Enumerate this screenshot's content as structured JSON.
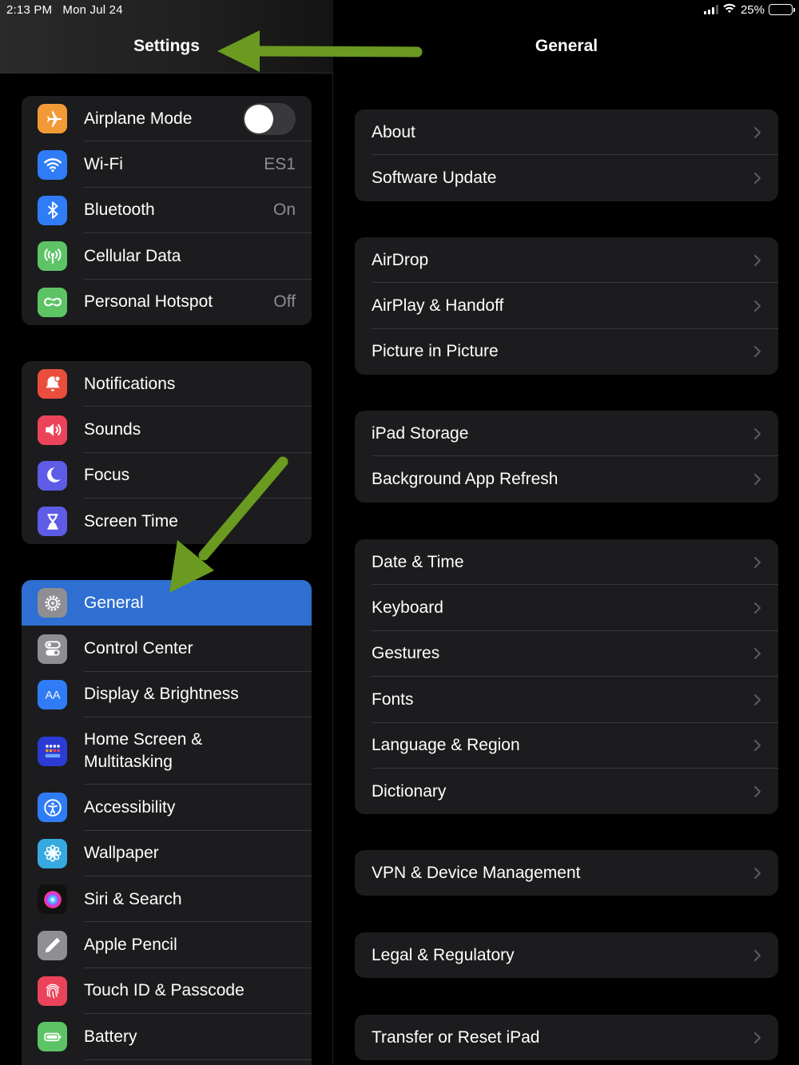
{
  "status": {
    "time": "2:13 PM",
    "date": "Mon Jul 24",
    "battery": "25%",
    "battery_level": 0.25
  },
  "sidebar": {
    "title": "Settings",
    "groups": [
      {
        "items": [
          {
            "label": "Airplane Mode",
            "icon": "airplane-icon",
            "color": "#f19a37",
            "toggle": false
          },
          {
            "label": "Wi-Fi",
            "value": "ES1",
            "icon": "wifi-icon",
            "color": "#2f7cf6"
          },
          {
            "label": "Bluetooth",
            "value": "On",
            "icon": "bluetooth-icon",
            "color": "#2f7cf6"
          },
          {
            "label": "Cellular Data",
            "icon": "antenna-icon",
            "color": "#5dc466"
          },
          {
            "label": "Personal Hotspot",
            "value": "Off",
            "icon": "hotspot-icon",
            "color": "#5dc466"
          }
        ]
      },
      {
        "items": [
          {
            "label": "Notifications",
            "icon": "bell-icon",
            "color": "#eb4d3d"
          },
          {
            "label": "Sounds",
            "icon": "speaker-icon",
            "color": "#eb445a"
          },
          {
            "label": "Focus",
            "icon": "moon-icon",
            "color": "#5e5ce6"
          },
          {
            "label": "Screen Time",
            "icon": "hourglass-icon",
            "color": "#5e5ce6"
          }
        ]
      },
      {
        "items": [
          {
            "label": "General",
            "icon": "gear-icon",
            "color": "#8e8e93",
            "selected": true
          },
          {
            "label": "Control Center",
            "icon": "switches-icon",
            "color": "#8e8e93"
          },
          {
            "label": "Display & Brightness",
            "icon": "text-size-icon",
            "color": "#2f7cf6"
          },
          {
            "label": "Home Screen &",
            "label2": "Multitasking",
            "icon": "home-grid-icon",
            "color": "#2b3bd4"
          },
          {
            "label": "Accessibility",
            "icon": "accessibility-icon",
            "color": "#2f7cf6"
          },
          {
            "label": "Wallpaper",
            "icon": "flower-icon",
            "color": "#36a9e1"
          },
          {
            "label": "Siri & Search",
            "icon": "siri-icon",
            "color": "#222"
          },
          {
            "label": "Apple Pencil",
            "icon": "pencil-icon",
            "color": "#8e8e93"
          },
          {
            "label": "Touch ID & Passcode",
            "icon": "fingerprint-icon",
            "color": "#eb445a"
          },
          {
            "label": "Battery",
            "icon": "battery-icon",
            "color": "#5dc466"
          }
        ]
      }
    ]
  },
  "main": {
    "title": "General",
    "groups": [
      {
        "items": [
          "About",
          "Software Update"
        ]
      },
      {
        "items": [
          "AirDrop",
          "AirPlay & Handoff",
          "Picture in Picture"
        ]
      },
      {
        "items": [
          "iPad Storage",
          "Background App Refresh"
        ]
      },
      {
        "items": [
          "Date & Time",
          "Keyboard",
          "Gestures",
          "Fonts",
          "Language & Region",
          "Dictionary"
        ]
      },
      {
        "items": [
          "VPN & Device Management"
        ]
      },
      {
        "items": [
          "Legal & Regulatory"
        ]
      },
      {
        "items": [
          "Transfer or Reset iPad"
        ]
      }
    ]
  },
  "annotations": {
    "arrow_color": "#6a9a1f"
  }
}
